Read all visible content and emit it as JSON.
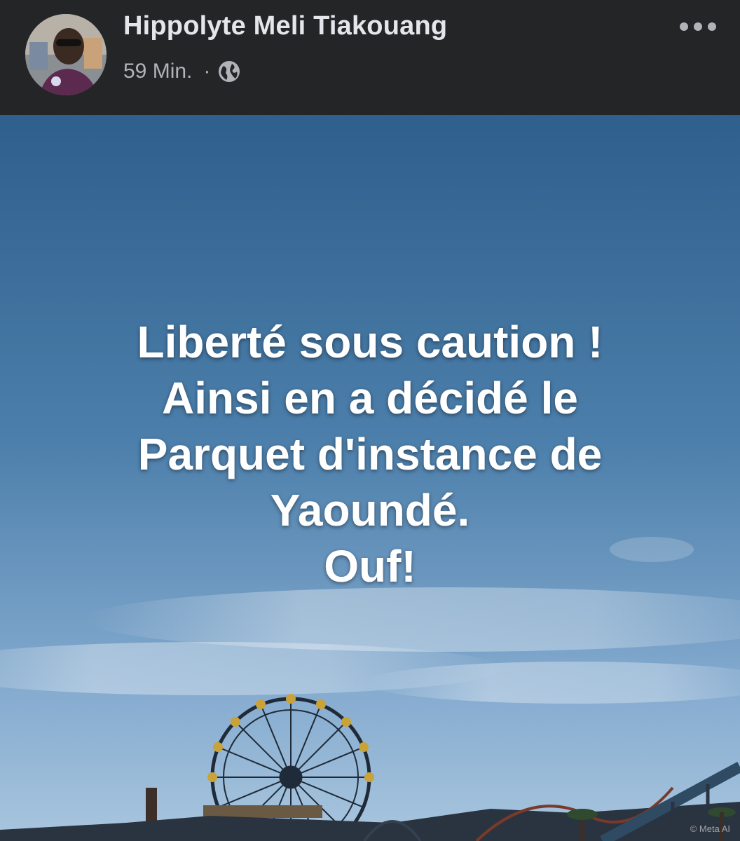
{
  "post": {
    "author": "Hippolyte Meli Tiakouang",
    "time": "59 Min.",
    "separator": "·",
    "privacy_icon": "globe-icon",
    "menu_icon": "more-horizontal-icon",
    "caption_lines": [
      "Liberté sous caution !",
      "Ainsi en a décidé le",
      "Parquet d'instance de",
      "Yaoundé.",
      "Ouf!"
    ],
    "background": "sky-with-ferris-wheel-amusement-park",
    "watermark": "© Meta AI"
  },
  "colors": {
    "header_bg": "#242526",
    "author_text": "#e4e6eb",
    "meta_text": "#b0b3b8",
    "sky_top": "#2f5f8c",
    "sky_bottom": "#a9c6de",
    "caption_text": "#ffffff"
  }
}
